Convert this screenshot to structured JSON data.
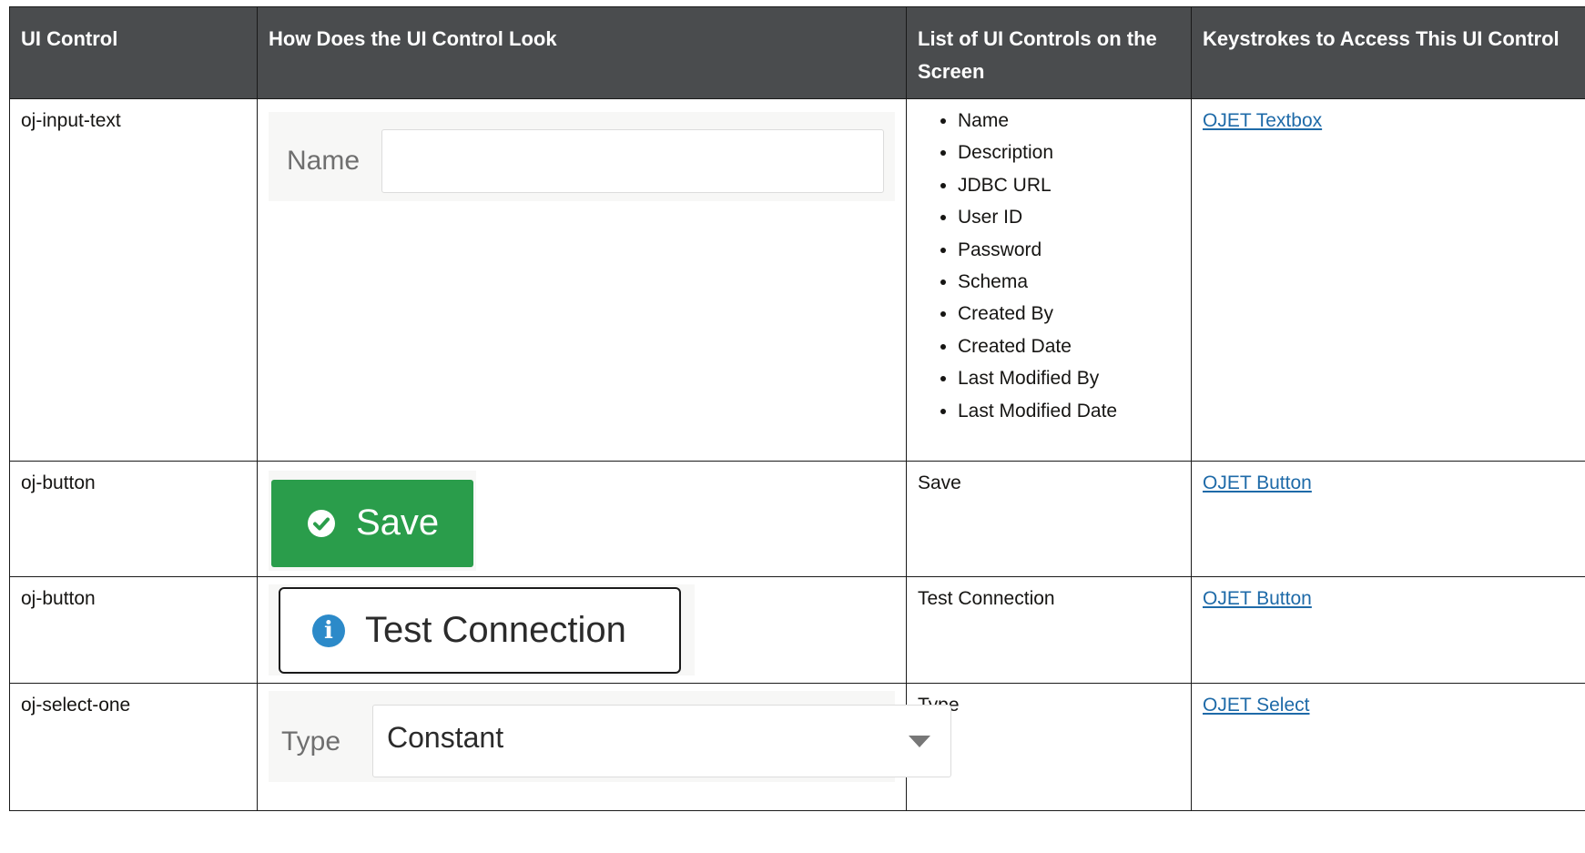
{
  "headers": [
    "UI Control",
    "How Does the UI Control Look",
    "List of UI Controls on the Screen",
    "Keystrokes to Access This UI Control"
  ],
  "rows": [
    {
      "control": "oj-input-text",
      "sample_label": "Name",
      "list": [
        "Name",
        "Description",
        "JDBC URL",
        "User ID",
        "Password",
        "Schema",
        "Created By",
        "Created Date",
        "Last Modified By",
        "Last Modified Date"
      ],
      "link": "OJET Textbox"
    },
    {
      "control": "oj-button",
      "sample_label": "Save",
      "sample_icon": "check-circle-icon",
      "sample_color": "#2a9d4b",
      "list_text": "Save",
      "link": "OJET Button"
    },
    {
      "control": "oj-button",
      "sample_label": "Test Connection",
      "sample_icon": "info-icon",
      "sample_color": "#2c8ac9",
      "list_text": "Test Connection",
      "link": "OJET Button"
    },
    {
      "control": "oj-select-one",
      "sample_label": "Type",
      "sample_value": "Constant",
      "list_text": "Type",
      "link": "OJET Select"
    }
  ]
}
